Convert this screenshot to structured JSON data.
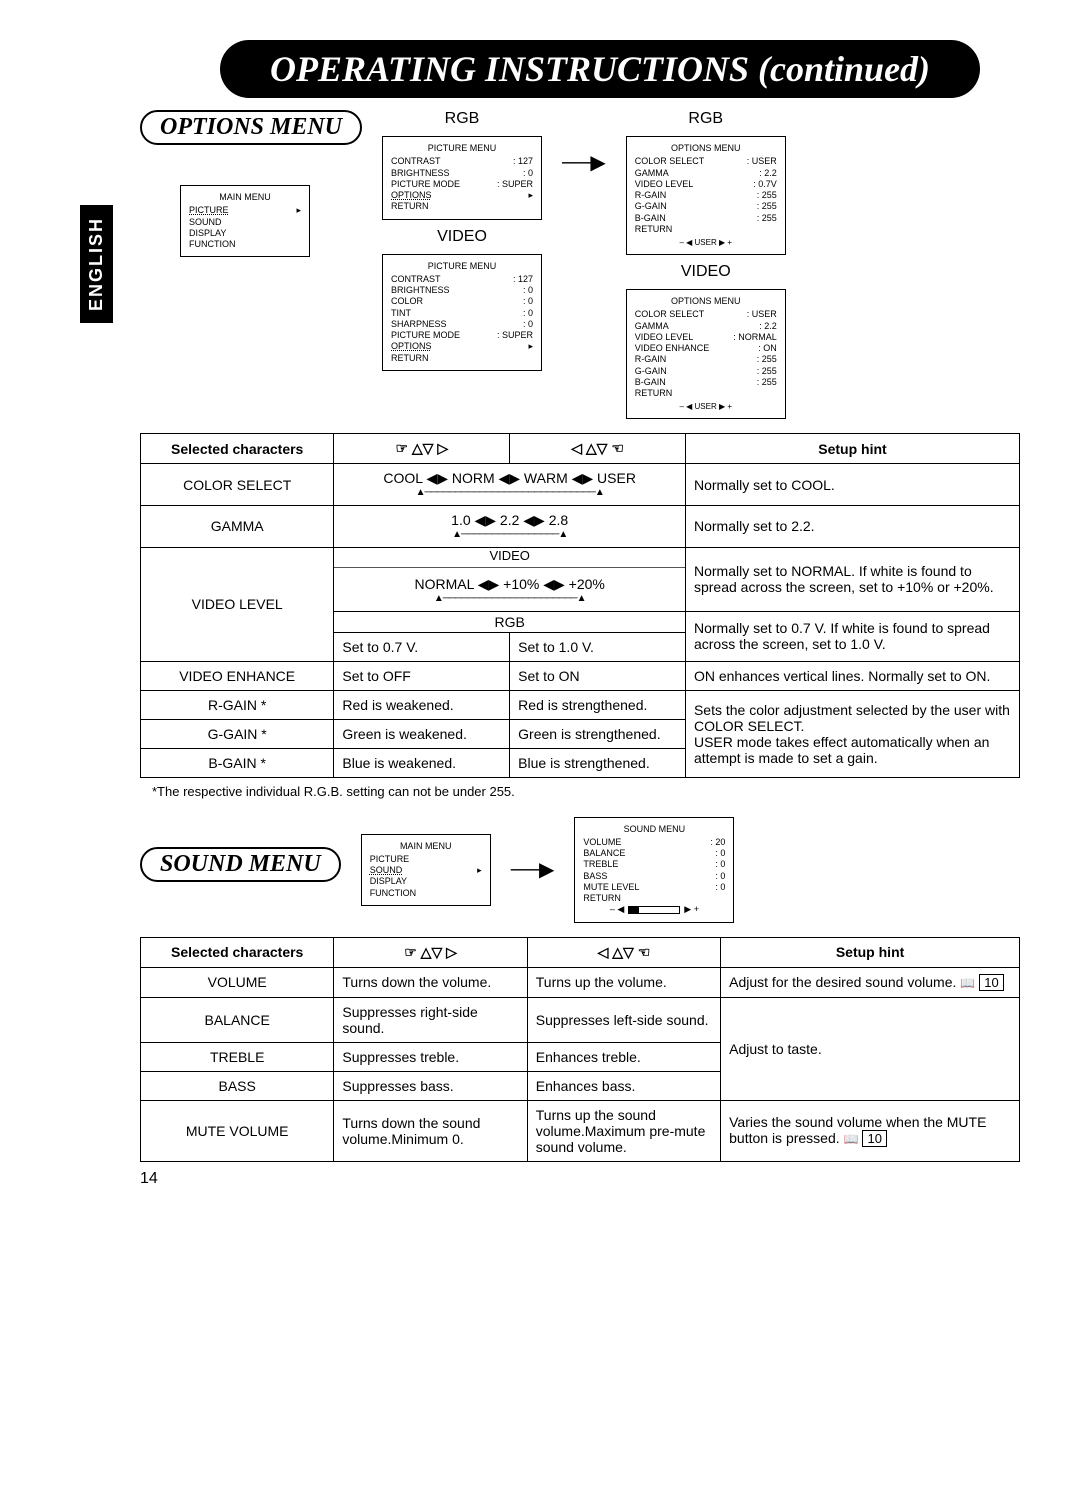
{
  "page_title": "OPERATING INSTRUCTIONS (continued)",
  "language_tab": "ENGLISH",
  "page_number": "14",
  "sections": {
    "options": {
      "pill": "OPTIONS MENU",
      "main_menu": {
        "title": "MAIN MENU",
        "items": [
          "PICTURE",
          "SOUND",
          "DISPLAY",
          "FUNCTION"
        ],
        "highlighted": "PICTURE"
      },
      "columns": [
        {
          "mode_top": "RGB",
          "block_top": {
            "title": "PICTURE MENU",
            "rows": [
              [
                "CONTRAST",
                ": 127"
              ],
              [
                "BRIGHTNESS",
                ": 0"
              ],
              [
                "PICTURE MODE",
                ": SUPER"
              ]
            ],
            "hl_row": "OPTIONS",
            "tail": [
              "RETURN"
            ]
          },
          "mode_bottom": "VIDEO",
          "block_bottom": {
            "title": "PICTURE MENU",
            "rows": [
              [
                "CONTRAST",
                ": 127"
              ],
              [
                "BRIGHTNESS",
                ": 0"
              ],
              [
                "COLOR",
                ": 0"
              ],
              [
                "TINT",
                ": 0"
              ],
              [
                "SHARPNESS",
                ": 0"
              ],
              [
                "PICTURE MODE",
                ": SUPER"
              ]
            ],
            "hl_row": "OPTIONS",
            "tail": [
              "RETURN"
            ]
          }
        },
        {
          "mode_top": "RGB",
          "block_top": {
            "title": "OPTIONS MENU",
            "rows": [
              [
                "COLOR SELECT",
                ": USER"
              ],
              [
                "GAMMA",
                ": 2.2"
              ],
              [
                "VIDEO LEVEL",
                ": 0.7V"
              ],
              [
                "R-GAIN",
                ": 255"
              ],
              [
                "G-GAIN",
                ": 255"
              ],
              [
                "B-GAIN",
                ": 255"
              ]
            ],
            "tail": [
              "RETURN"
            ],
            "note": "– ◀ USER   ▶ +"
          },
          "mode_bottom": "VIDEO",
          "block_bottom": {
            "title": "OPTIONS MENU",
            "rows": [
              [
                "COLOR SELECT",
                ": USER"
              ],
              [
                "GAMMA",
                ": 2.2"
              ],
              [
                "VIDEO LEVEL",
                ": NORMAL"
              ],
              [
                "VIDEO ENHANCE",
                ": ON"
              ],
              [
                "R-GAIN",
                ": 255"
              ],
              [
                "G-GAIN",
                ": 255"
              ],
              [
                "B-GAIN",
                ": 255"
              ]
            ],
            "tail": [
              "RETURN"
            ],
            "note": "– ◀ USER   ▶ +"
          }
        }
      ],
      "table": {
        "headers": [
          "Selected characters",
          "nav-left",
          "nav-right",
          "Setup hint"
        ],
        "rows": [
          {
            "name": "COLOR SELECT",
            "cycle": "COOL ◀▶ NORM ◀▶ WARM ◀▶ USER",
            "under": "▲────────────────────────────▲",
            "hint": "Normally set to COOL."
          },
          {
            "name": "GAMMA",
            "cycle": "1.0 ◀▶ 2.2 ◀▶ 2.8",
            "under": "▲────────────────▲",
            "hint": "Normally set to 2.2."
          },
          {
            "name": "VIDEO LEVEL",
            "video_sub": "VIDEO",
            "video_cycle": "NORMAL ◀▶ +10% ◀▶ +20%",
            "video_under": "▲──────────────────────▲",
            "video_hint": "Normally set to NORMAL. If white is found to spread across the screen, set to +10% or +20%.",
            "rgb_sub": "RGB",
            "rgb_left": "Set to 0.7 V.",
            "rgb_right": "Set to 1.0 V.",
            "rgb_hint": "Normally set to 0.7 V. If white is found to spread across the screen, set to 1.0 V."
          },
          {
            "name": "VIDEO ENHANCE",
            "left": "Set to OFF",
            "right": "Set to ON",
            "hint": "ON enhances vertical lines. Normally set to ON."
          },
          {
            "name": "R-GAIN *",
            "left": "Red is weakened.",
            "right": "Red is strengthened.",
            "gain_hint": "Sets the color adjustment selected by the user with COLOR SELECT.\nUSER mode takes effect automatically when an attempt is made to set a gain."
          },
          {
            "name": "G-GAIN *",
            "left": "Green is weakened.",
            "right": "Green is strengthened."
          },
          {
            "name": "B-GAIN *",
            "left": "Blue is weakened.",
            "right": "Blue is strengthened."
          }
        ],
        "footnote": "*The respective individual R.G.B. setting can not be under 255."
      }
    },
    "sound": {
      "pill": "SOUND MENU",
      "main_menu": {
        "title": "MAIN MENU",
        "items": [
          "PICTURE",
          "SOUND",
          "DISPLAY",
          "FUNCTION"
        ],
        "highlighted": "SOUND"
      },
      "sound_block": {
        "title": "SOUND MENU",
        "rows": [
          [
            "VOLUME",
            ": 20"
          ],
          [
            "BALANCE",
            ": 0"
          ],
          [
            "TREBLE",
            ": 0"
          ],
          [
            "BASS",
            ": 0"
          ],
          [
            "MUTE LEVEL",
            ": 0"
          ]
        ],
        "tail": [
          "RETURN"
        ],
        "note_left": "– ◀",
        "note_right": "▶ +"
      },
      "table": {
        "headers": [
          "Selected characters",
          "nav-left",
          "nav-right",
          "Setup hint"
        ],
        "rows": [
          {
            "name": "VOLUME",
            "left": "Turns down the volume.",
            "right": "Turns up the volume.",
            "hint": "Adjust for the desired sound volume.",
            "ref": "10"
          },
          {
            "name": "BALANCE",
            "left": "Suppresses right-side sound.",
            "right": "Suppresses left-side sound.",
            "taste_hint": "Adjust to taste."
          },
          {
            "name": "TREBLE",
            "left": "Suppresses treble.",
            "right": "Enhances treble."
          },
          {
            "name": "BASS",
            "left": "Suppresses bass.",
            "right": "Enhances bass."
          },
          {
            "name": "MUTE VOLUME",
            "left": "Turns down the sound volume.Minimum 0.",
            "right": "Turns up the sound volume.Maximum pre-mute sound volume.",
            "hint": "Varies the sound volume when the MUTE button is pressed.",
            "ref": "10"
          }
        ]
      }
    }
  }
}
